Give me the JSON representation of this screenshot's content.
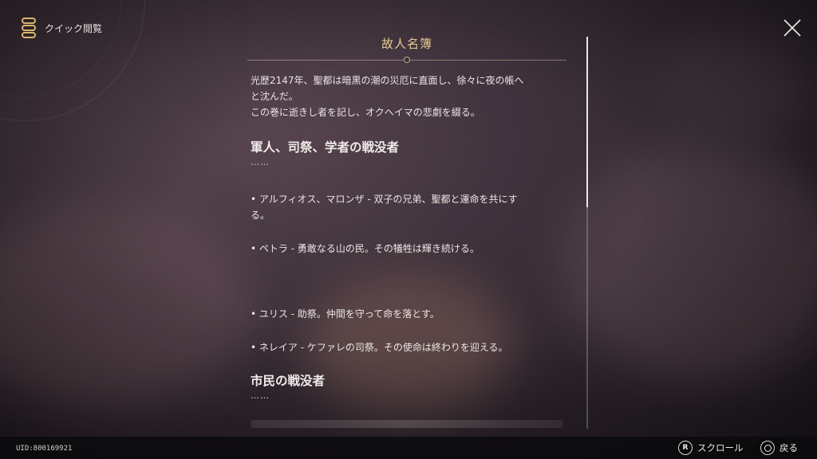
{
  "header": {
    "quick_read_label": "クイック閲覧",
    "book_icon": "book-stack-icon",
    "close_icon": "close-icon"
  },
  "document": {
    "title": "故人名簿",
    "intro_line1": "光歴2147年、聖都は暗黒の潮の災厄に直面し、徐々に夜の帳へ",
    "intro_line2": "と沈んだ。",
    "intro_line3": "この巻に逝きし者を記し、オクヘイマの悲劇を綴る。",
    "section1_heading": "軍人、司祭、学者の戦没者",
    "section1_ellipsis": "……",
    "entries": [
      {
        "line1": "• アルフィオス、マロンザ - 双子の兄弟、聖都と運命を共にす",
        "line2": "る。"
      },
      {
        "line1": "• ペトラ - 勇敢なる山の民。その犠牲は輝き続ける。"
      },
      {
        "line1": "• ユリス - 助祭。仲間を守って命を落とす。"
      },
      {
        "line1": "• ネレイア - ケファレの司祭。その使命は終わりを迎える。"
      }
    ],
    "section2_heading": "市民の戦没者",
    "section2_ellipsis": "……"
  },
  "footer": {
    "uid": "UID:800169921",
    "scroll_button": "R",
    "scroll_label": "スクロール",
    "back_label": "戻る"
  },
  "colors": {
    "title": "#e8cd96",
    "text": "#ebe6e3",
    "bar": "#0a0a0c"
  }
}
